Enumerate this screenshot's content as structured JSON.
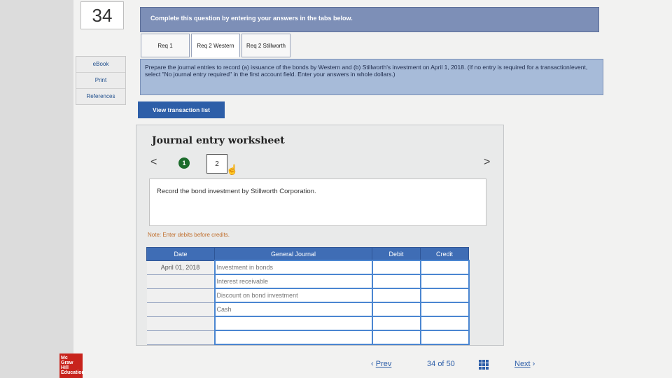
{
  "question_number": "34",
  "side_tools": [
    "eBook",
    "Print",
    "References"
  ],
  "banner_text": "Complete this question by entering your answers in the tabs below.",
  "tabs": [
    {
      "label": "Req 1"
    },
    {
      "label": "Req 2 Western"
    },
    {
      "label": "Req 2 Stillworth"
    }
  ],
  "instructions": "Prepare the journal entries to record (a) issuance of the bonds by Western and (b) Stillworth's investment on April 1, 2018. (If no entry is required for a transaction/event, select \"No journal entry required\" in the first account field. Enter your answers in whole dollars.)",
  "view_transaction_label": "View transaction list",
  "worksheet": {
    "title": "Journal entry worksheet",
    "prev_arrow": "<",
    "next_arrow": ">",
    "step1": "1",
    "step2": "2",
    "record_text": "Record the bond investment by Stillworth Corporation.",
    "note": "Note: Enter debits before credits."
  },
  "journal": {
    "headers": {
      "date": "Date",
      "general_journal": "General Journal",
      "debit": "Debit",
      "credit": "Credit"
    },
    "rows": [
      {
        "date": "April 01, 2018",
        "account": "Investment in bonds"
      },
      {
        "date": "",
        "account": "Interest receivable"
      },
      {
        "date": "",
        "account": "Discount on bond investment"
      },
      {
        "date": "",
        "account": "Cash"
      },
      {
        "date": "",
        "account": ""
      },
      {
        "date": "",
        "account": ""
      }
    ]
  },
  "footer": {
    "logo_text": "Mc Graw Hill Education",
    "prev_label": "Prev",
    "page_current": "34",
    "page_of": "of",
    "page_total": "50",
    "next_label": "Next"
  }
}
